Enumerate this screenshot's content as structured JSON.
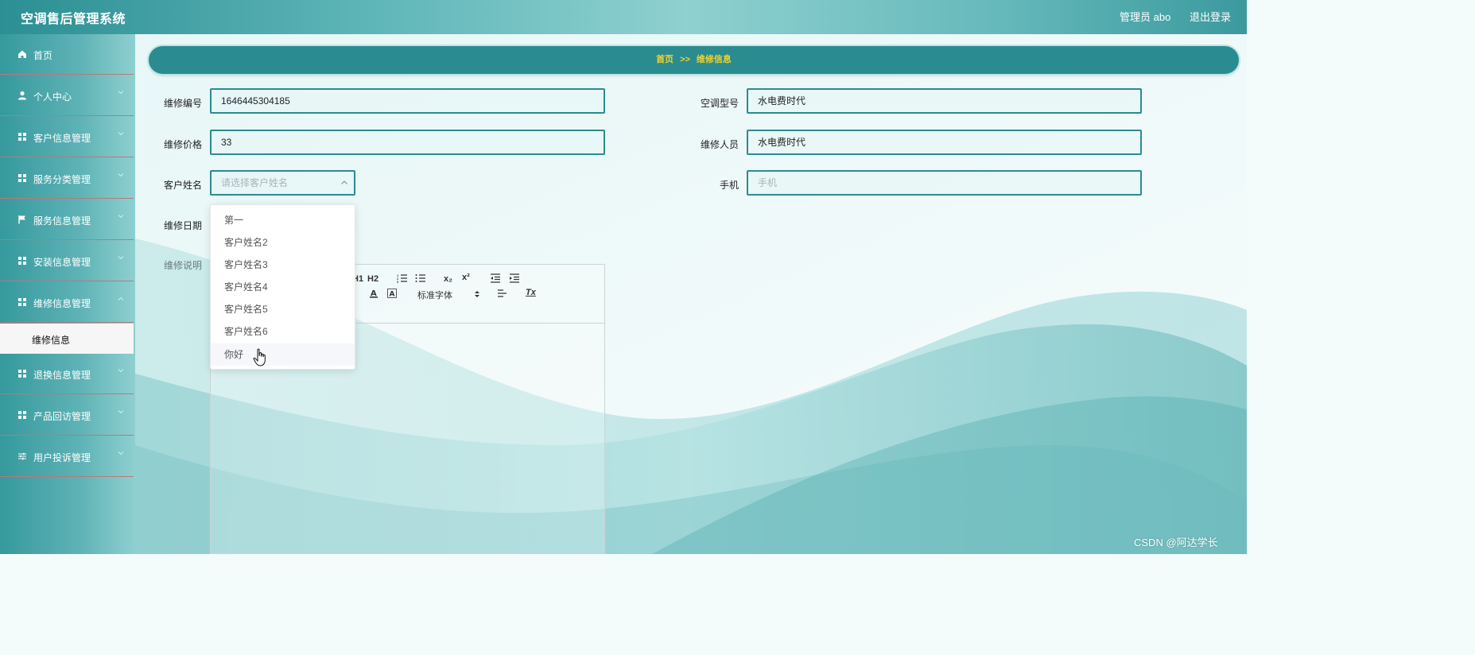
{
  "header": {
    "title": "空调售后管理系统",
    "user": "管理员 abo",
    "logout": "退出登录"
  },
  "sidebar": {
    "items": [
      {
        "label": "首页",
        "icon": "home-icon"
      },
      {
        "label": "个人中心",
        "icon": "user-icon"
      },
      {
        "label": "客户信息管理",
        "icon": "grid-icon"
      },
      {
        "label": "服务分类管理",
        "icon": "grid-icon"
      },
      {
        "label": "服务信息管理",
        "icon": "flag-icon"
      },
      {
        "label": "安装信息管理",
        "icon": "grid-icon"
      },
      {
        "label": "维修信息管理",
        "icon": "grid-icon"
      },
      {
        "label": "退换信息管理",
        "icon": "grid-icon"
      },
      {
        "label": "产品回访管理",
        "icon": "grid-icon"
      },
      {
        "label": "用户投诉管理",
        "icon": "sliders-icon"
      }
    ],
    "active_sub": "维修信息"
  },
  "breadcrumb": {
    "home": "首页",
    "separator": ">>",
    "current": "维修信息"
  },
  "form": {
    "repair_no": {
      "label": "维修编号",
      "value": "1646445304185"
    },
    "ac_model": {
      "label": "空调型号",
      "value": "水电费时代"
    },
    "repair_price": {
      "label": "维修价格",
      "value": "33"
    },
    "repair_staff": {
      "label": "维修人员",
      "value": "水电费时代"
    },
    "customer_name": {
      "label": "客户姓名",
      "placeholder": "请选择客户姓名"
    },
    "phone": {
      "label": "手机",
      "placeholder": "手机"
    },
    "repair_date": {
      "label": "维修日期"
    },
    "repair_desc": {
      "label": "维修说明"
    }
  },
  "dropdown": {
    "options": [
      "第一",
      "客户姓名2",
      "客户姓名3",
      "客户姓名4",
      "客户姓名5",
      "客户姓名6",
      "你好"
    ],
    "hovered": "你好"
  },
  "editor": {
    "toolbar": {
      "h1": "H1",
      "h2": "H2",
      "subscript": "x₂",
      "superscript": "x²",
      "font": "标准字体",
      "clear": "Tx"
    }
  },
  "watermark": "CSDN @阿达学长",
  "colors": {
    "accent": "#2a8c90",
    "breadcrumb_text": "#f5d22a",
    "sidebar_divider": "#b47b7b"
  }
}
